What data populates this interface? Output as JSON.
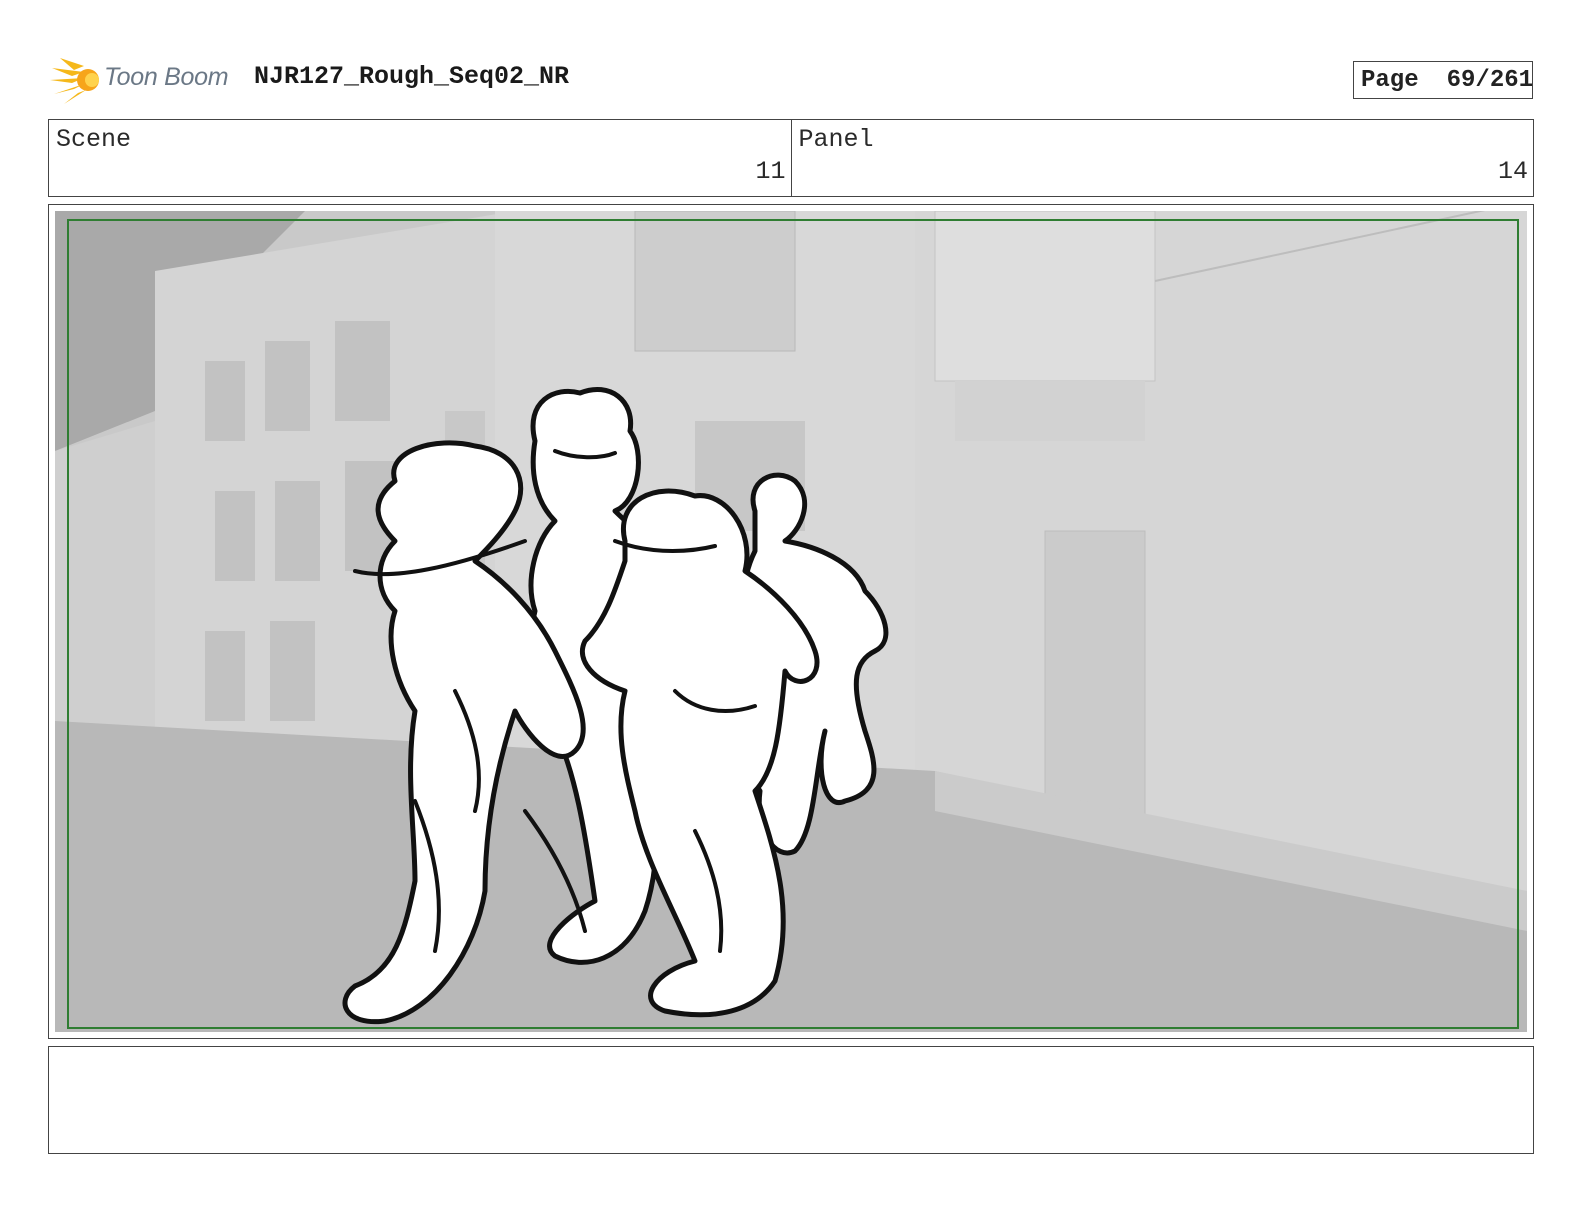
{
  "header": {
    "logo_text": "Toon Boom",
    "document_title": "NJR127_Rough_Seq02_NR",
    "page_label": "Page",
    "page_number": "69/261"
  },
  "info": {
    "scene_label": "Scene",
    "scene_value": "11",
    "panel_label": "Panel",
    "panel_value": "14"
  },
  "panel": {
    "description": "",
    "safe_frame_color": "#2f7d32"
  },
  "notes": {
    "text": ""
  }
}
